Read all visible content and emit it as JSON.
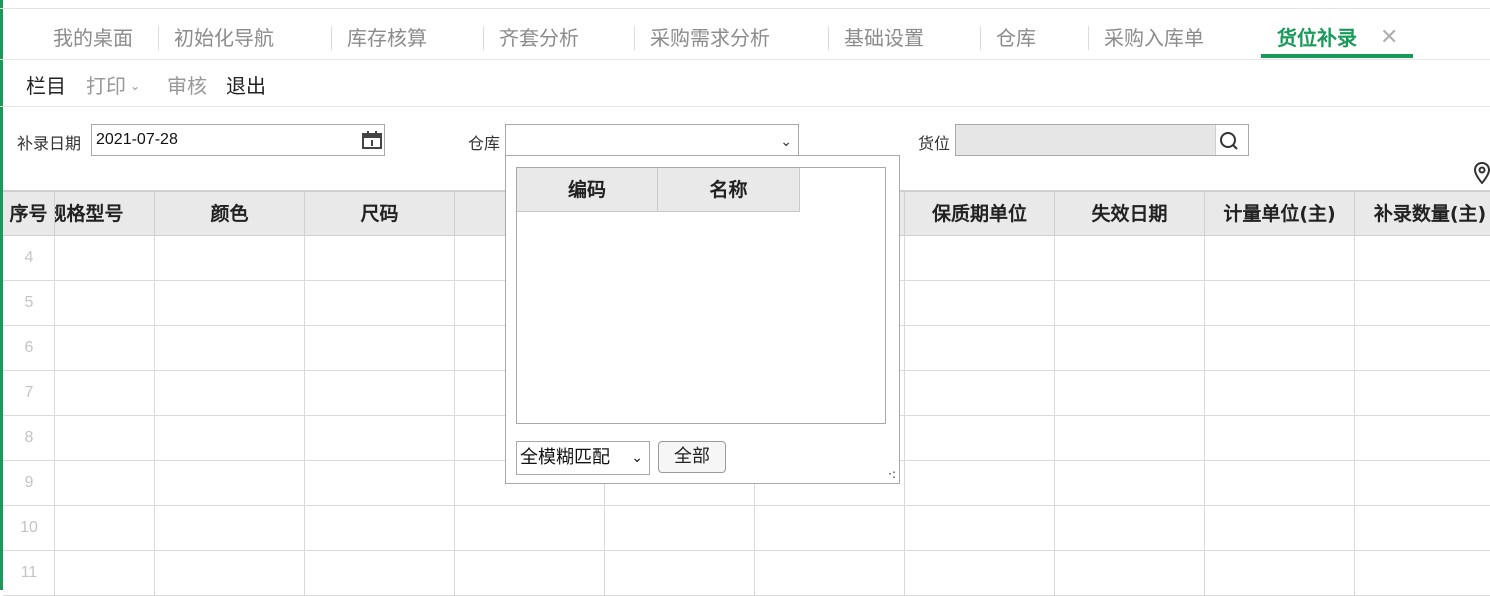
{
  "tabs": [
    {
      "label": "我的桌面"
    },
    {
      "label": "初始化导航"
    },
    {
      "label": "库存核算"
    },
    {
      "label": "齐套分析"
    },
    {
      "label": "采购需求分析"
    },
    {
      "label": "基础设置"
    },
    {
      "label": "仓库"
    },
    {
      "label": "采购入库单"
    },
    {
      "label": "货位补录",
      "active": true,
      "close": "✕"
    }
  ],
  "toolbar": {
    "columns": "栏目",
    "print": "打印",
    "audit": "审核",
    "exit": "退出"
  },
  "form": {
    "date_label": "补录日期",
    "date_value": "2021-07-28",
    "warehouse_label": "仓库",
    "warehouse_value": "",
    "location_label": "货位",
    "location_value": ""
  },
  "grid": {
    "headers": [
      "序号",
      "规格型号",
      "颜色",
      "尺码",
      "",
      "",
      "保质期单位",
      "失效日期",
      "计量单位(主)",
      "补录数量(主)"
    ],
    "row_numbers": [
      "4",
      "5",
      "6",
      "7",
      "8",
      "9",
      "10",
      "11"
    ]
  },
  "popup": {
    "headers": [
      "编码",
      "名称"
    ],
    "match_mode": "全模糊匹配",
    "all_button": "全部"
  },
  "colors": {
    "accent": "#1a9a5a"
  }
}
